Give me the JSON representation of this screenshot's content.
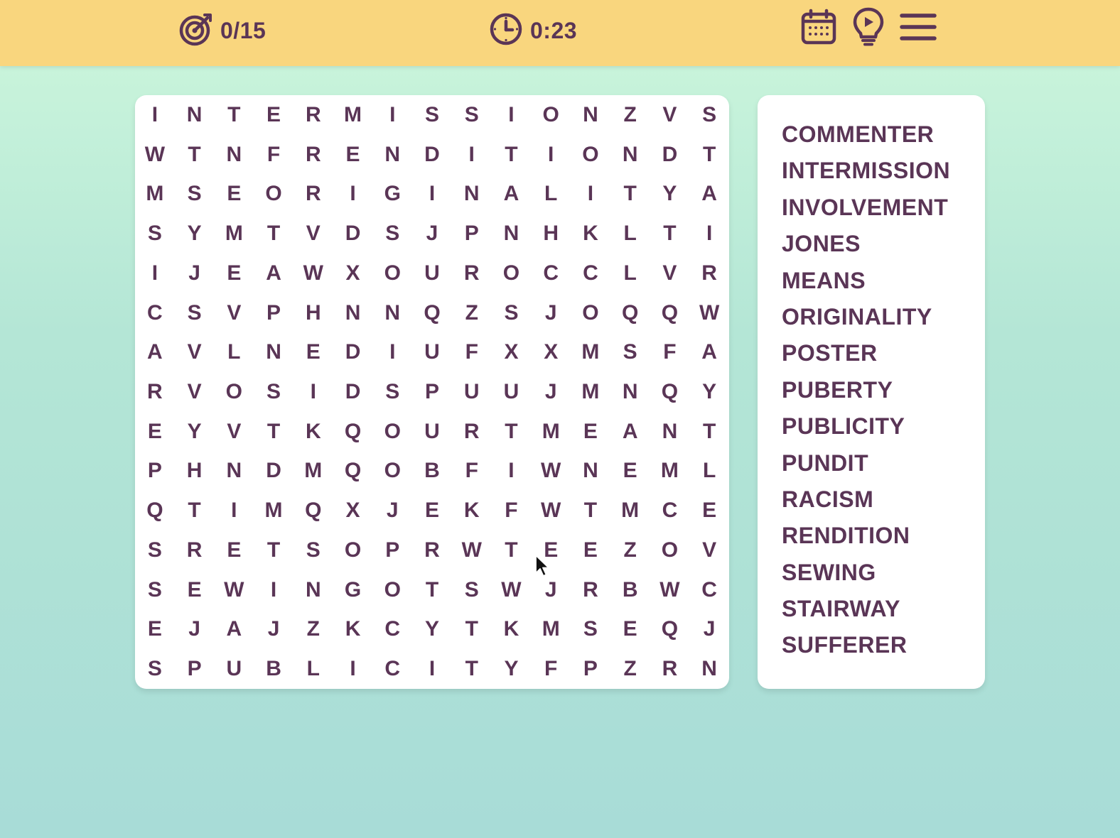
{
  "header": {
    "found_count": "0/15",
    "timer": "0:23",
    "icons": {
      "target": "target-icon",
      "clock": "clock-icon",
      "calendar": "calendar-icon",
      "hint": "lightbulb-play-icon",
      "menu": "menu-icon"
    },
    "colors": {
      "bar": "#f9d67e",
      "ink": "#5a3556"
    }
  },
  "grid": {
    "rows": [
      "INTERMISSIONZVS",
      "WTNFRENDITIONDT",
      "MSEORIGINALITYA",
      "SYMTVDSJPNHKLTI",
      "IJEAWXOUROCCLVR",
      "CSVPHNNQZSJOQQW",
      "AVLNEDIUFXXMSFA",
      "RVOSIDSPUUJMNQY",
      "EYVTKQOURTMEANT",
      "PHNDMQOBFIWNEML",
      "QTIMQXJEKFWTMCE",
      "SRETSOPRWTEEZOV",
      "SEWINGOTSWJRBWC",
      "EJAJZKCYTKMSEQJ",
      "SPUBLICITYFPZRN"
    ]
  },
  "word_list": [
    "COMMENTER",
    "INTERMISSION",
    "INVOLVEMENT",
    "JONES",
    "MEANS",
    "ORIGINALITY",
    "POSTER",
    "PUBERTY",
    "PUBLICITY",
    "PUNDIT",
    "RACISM",
    "RENDITION",
    "SEWING",
    "STAIRWAY",
    "SUFFERER"
  ]
}
